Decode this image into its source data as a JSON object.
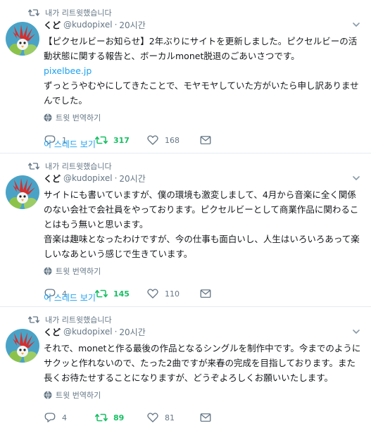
{
  "colors": {
    "accent": "#1da1f2",
    "retweet_green": "#17bf63",
    "muted": "#657786",
    "border": "#e6ecf0"
  },
  "tweets": [
    {
      "retweet_label": "내가 리트윗했습니다",
      "name": "くど",
      "handle": "@kudopixel",
      "dot": "·",
      "time": "20시간",
      "lines": [
        "【ピクセルビーお知らせ】2年ぶりにサイトを更新しました。ピクセルビーの活",
        "動状態に関する報告と、ボーカルmonet脱退のごあいさつです。"
      ],
      "link": "pixelbee.jp",
      "lines_after": [
        "ずっとうやむやにしてきたことで、モヤモヤしていた方がいたら申し訳ありませ",
        "んでした。"
      ],
      "translate_label": "트윗 번역하기",
      "reply_count": "1",
      "retweet_count": "317",
      "like_count": "168",
      "thread_label": "이 스레드 보기"
    },
    {
      "retweet_label": "내가 리트윗했습니다",
      "name": "くど",
      "handle": "@kudopixel",
      "dot": "·",
      "time": "20시간",
      "lines": [
        "サイトにも書いていますが、僕の環境も激変しまして、4月から音楽に全く関係",
        "のない会社で会社員をやっております。ピクセルビーとして商業作品に関わるこ",
        "とはもう無いと思います。",
        "音楽は趣味となったわけですが、今の仕事も面白いし、人生はいろいろあって楽",
        "しいなあという感じで生きています。"
      ],
      "translate_label": "트윗 번역하기",
      "reply_count": "4",
      "retweet_count": "145",
      "like_count": "110",
      "thread_label": "이 스레드 보기"
    },
    {
      "retweet_label": "내가 리트윗했습니다",
      "name": "くど",
      "handle": "@kudopixel",
      "dot": "·",
      "time": "20시간",
      "lines": [
        "それで、monetと作る最後の作品となるシングルを制作中です。今までのように",
        "サクッと作れないので、たった2曲ですが来春の完成を目指しております。また",
        "長くお待たせすることになりますが、どうぞよろしくお願いいたします。"
      ],
      "translate_label": "트윗 번역하기",
      "reply_count": "4",
      "retweet_count": "89",
      "like_count": "81"
    }
  ]
}
